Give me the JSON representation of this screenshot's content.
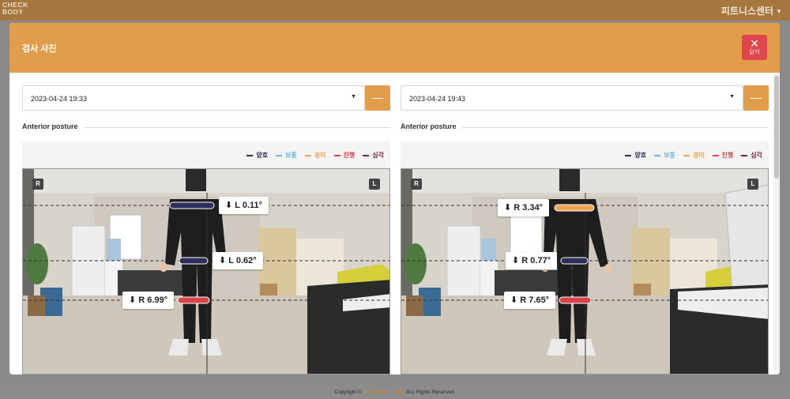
{
  "app": {
    "logo_line1": "CHECK",
    "logo_line2": "BODY",
    "center_name": "피트니스센터"
  },
  "modal": {
    "title": "검사 사진",
    "close_label": "닫기",
    "close_icon": "close-icon"
  },
  "legend": [
    {
      "label": "양호",
      "color": "#2c2f5c"
    },
    {
      "label": "보통",
      "color": "#6bb8dd"
    },
    {
      "label": "경미",
      "color": "#f0a556"
    },
    {
      "label": "진행",
      "color": "#d9434a"
    },
    {
      "label": "심각",
      "color": "#7a2530"
    }
  ],
  "panels": [
    {
      "date": "2023-04-24 19:33",
      "minus_label": "—",
      "section_title": "Anterior posture",
      "side_left": "R",
      "side_right": "L",
      "measurements": [
        {
          "label": "⬇ L 0.11°",
          "status_color": "#2c2f5c"
        },
        {
          "label": "⬇ L 0.62°",
          "status_color": "#2c2f5c"
        },
        {
          "label": "⬇ R 6.99°",
          "status_color": "#d9434a"
        }
      ]
    },
    {
      "date": "2023-04-24 19:43",
      "minus_label": "—",
      "section_title": "Anterior posture",
      "side_left": "R",
      "side_right": "L",
      "measurements": [
        {
          "label": "⬇ R 3.34°",
          "status_color": "#f0a556"
        },
        {
          "label": "⬇ R 0.77°",
          "status_color": "#2c2f5c"
        },
        {
          "label": "⬇ R 7.65°",
          "status_color": "#d9434a"
        }
      ]
    }
  ],
  "footer": {
    "prefix": "Copyright © ",
    "brand": "Team Elysium Inc.",
    "suffix": " ALL Rights Reserved."
  }
}
